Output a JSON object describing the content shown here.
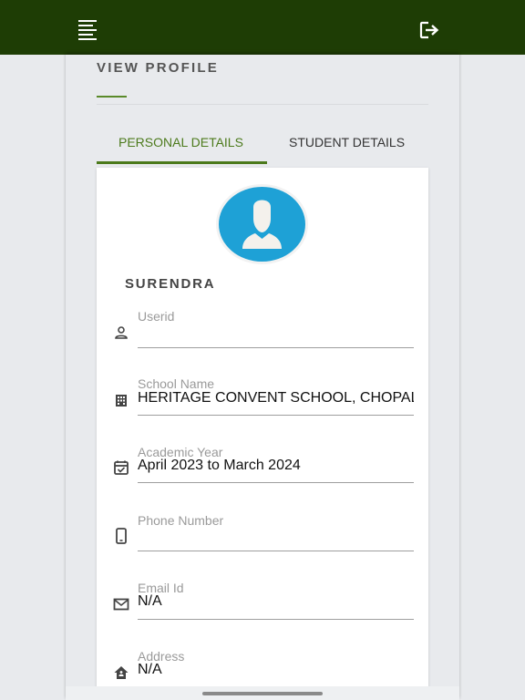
{
  "header": {
    "menu_icon": "menu-lines-icon",
    "logout_icon": "logout-icon",
    "background_color": "#1e3d05"
  },
  "page": {
    "title": "VIEW PROFILE"
  },
  "tabs": [
    {
      "label": "PERSONAL DETAILS",
      "active": true
    },
    {
      "label": "STUDENT DETAILS",
      "active": false
    }
  ],
  "profile": {
    "avatar_icon": "user-avatar-icon",
    "name": "SURENDRA"
  },
  "fields": [
    {
      "label": "Userid",
      "value": "",
      "icon": "person-icon"
    },
    {
      "label": "School Name",
      "value": "HERITAGE CONVENT SCHOOL, CHOPAL",
      "icon": "building-icon"
    },
    {
      "label": "Academic Year",
      "value": "April 2023 to March 2024",
      "icon": "calendar-icon"
    },
    {
      "label": "Phone Number",
      "value": "",
      "icon": "phone-icon"
    },
    {
      "label": "Email Id",
      "value": "N/A",
      "icon": "email-icon"
    },
    {
      "label": "Address",
      "value": "N/A",
      "icon": "home-icon"
    }
  ],
  "colors": {
    "accent": "#4c7a1c",
    "avatar": "#1ea1d6"
  }
}
